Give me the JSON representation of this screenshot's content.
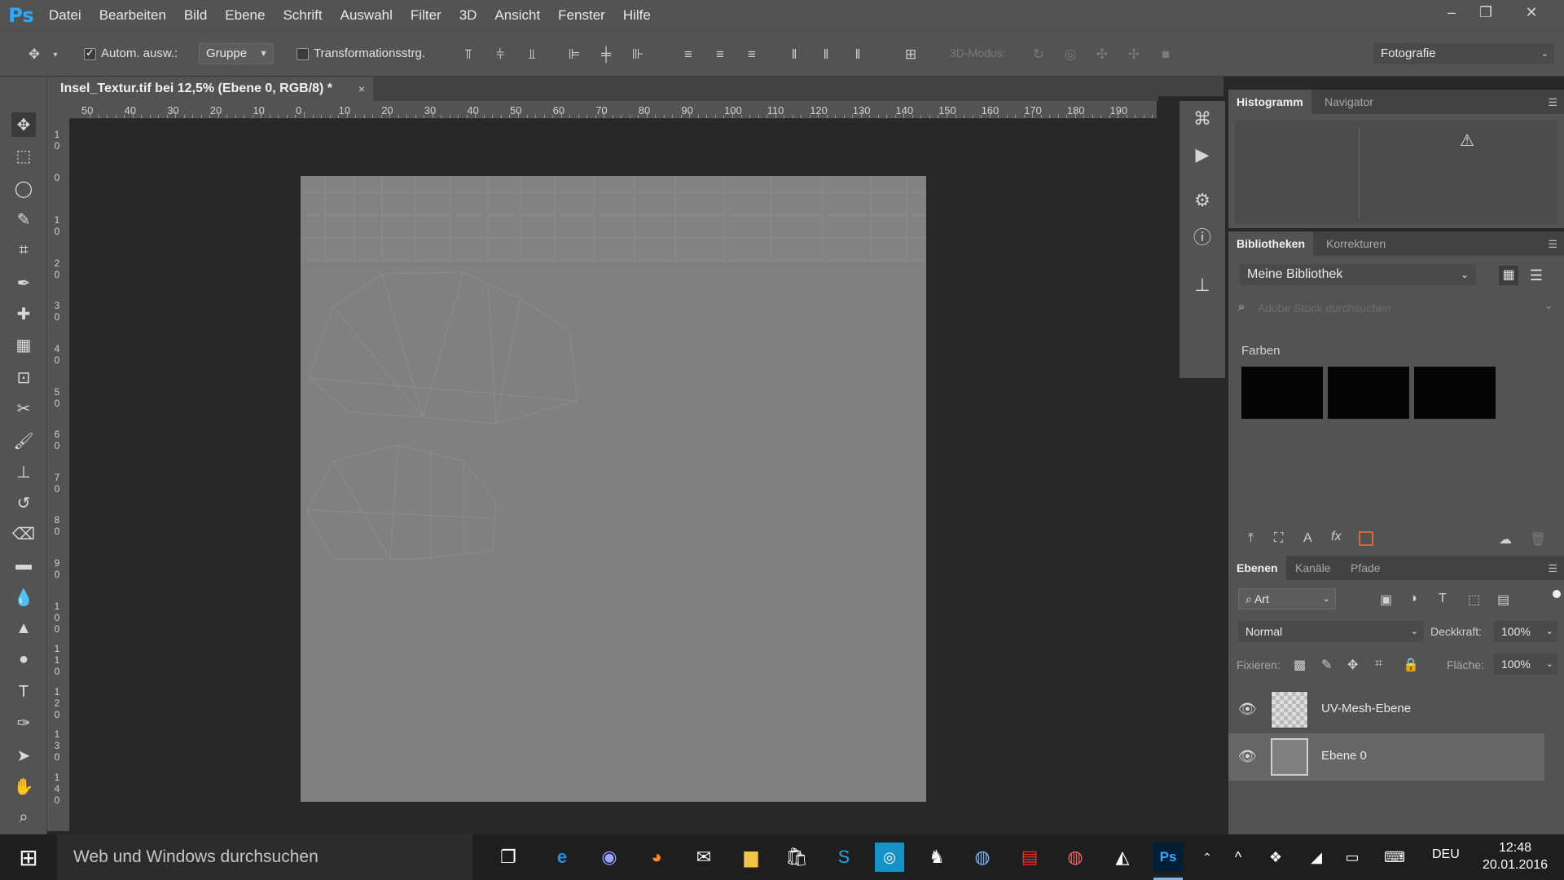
{
  "app": {
    "logo": "Ps"
  },
  "menu": [
    "Datei",
    "Bearbeiten",
    "Bild",
    "Ebene",
    "Schrift",
    "Auswahl",
    "Filter",
    "3D",
    "Ansicht",
    "Fenster",
    "Hilfe"
  ],
  "options_bar": {
    "auto_select_label": "Autom. ausw.:",
    "auto_select_checked": true,
    "auto_select_target": "Gruppe",
    "transform_label": "Transformationsstrg.",
    "transform_checked": false,
    "mode_3d_label": "3D-Modus:",
    "workspace": "Fotografie"
  },
  "document": {
    "tab_title": "Insel_Textur.tif bei 12,5% (Ebene 0, RGB/8) *",
    "close_symbol": "×"
  },
  "rulers": {
    "top_labels": [
      "50",
      "40",
      "30",
      "20",
      "10",
      "0",
      "10",
      "20",
      "30",
      "40",
      "50",
      "60",
      "70",
      "80",
      "90",
      "100",
      "110",
      "120",
      "130",
      "140",
      "150",
      "160",
      "170",
      "180",
      "190"
    ],
    "left_labels": [
      "10",
      "0",
      "10",
      "20",
      "30",
      "40",
      "50",
      "60",
      "70",
      "80",
      "90",
      "100",
      "110",
      "120",
      "130",
      "140"
    ]
  },
  "panels": {
    "histogram": {
      "tabs": [
        "Histogramm",
        "Navigator"
      ],
      "active": 0
    },
    "libraries": {
      "tabs": [
        "Bibliotheken",
        "Korrekturen"
      ],
      "active": 0,
      "library_name": "Meine Bibliothek",
      "search_placeholder": "Adobe Stock durchsuchen",
      "colors_heading": "Farben",
      "swatches": [
        "#050505",
        "#050505",
        "#050505"
      ]
    },
    "layers": {
      "tabs": [
        "Ebenen",
        "Kanäle",
        "Pfade"
      ],
      "active": 0,
      "filter_kind": "Art",
      "blend_mode": "Normal",
      "opacity_label": "Deckkraft:",
      "opacity_value": "100%",
      "lock_label": "Fixieren:",
      "fill_label": "Fläche:",
      "fill_value": "100%",
      "layers": [
        {
          "name": "UV-Mesh-Ebene",
          "visible": true,
          "selected": false
        },
        {
          "name": "Ebene 0",
          "visible": true,
          "selected": true
        }
      ]
    }
  },
  "taskbar": {
    "search_placeholder": "Web und Windows durchsuchen",
    "language": "DEU",
    "time": "12:48",
    "date": "20.01.2016"
  },
  "colors": {
    "ui_panel": "#535353",
    "ui_dark": "#282828",
    "canvas_gray": "#808080",
    "ps_blue": "#31a8ff"
  }
}
